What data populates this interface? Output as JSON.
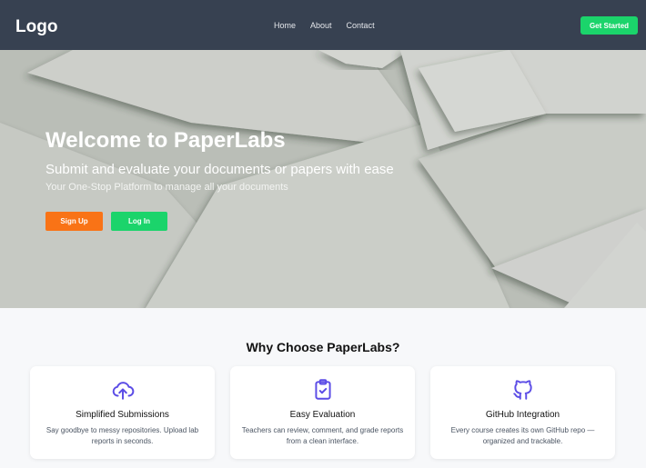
{
  "nav": {
    "logo": "Logo",
    "links": [
      "Home",
      "About",
      "Contact"
    ],
    "cta": "Get Started"
  },
  "hero": {
    "title": "Welcome to PaperLabs",
    "subtitle": "Submit and evaluate your documents or papers with ease",
    "tagline": "Your One-Stop Platform to manage all your documents",
    "signup": "Sign Up",
    "login": "Log In"
  },
  "features": {
    "heading": "Why Choose PaperLabs?",
    "cards": [
      {
        "icon": "cloud-upload-icon",
        "title": "Simplified Submissions",
        "desc": "Say goodbye to messy repositories. Upload lab reports in seconds."
      },
      {
        "icon": "clipboard-check-icon",
        "title": "Easy Evaluation",
        "desc": "Teachers can review, comment, and grade reports from a clean interface."
      },
      {
        "icon": "github-icon",
        "title": "GitHub Integration",
        "desc": "Every course creates its own GitHub repo — organized and trackable."
      }
    ]
  },
  "colors": {
    "navbar": "#374151",
    "accent_green": "#1bd46b",
    "accent_orange": "#f97316",
    "icon_purple": "#5b4ce6"
  }
}
